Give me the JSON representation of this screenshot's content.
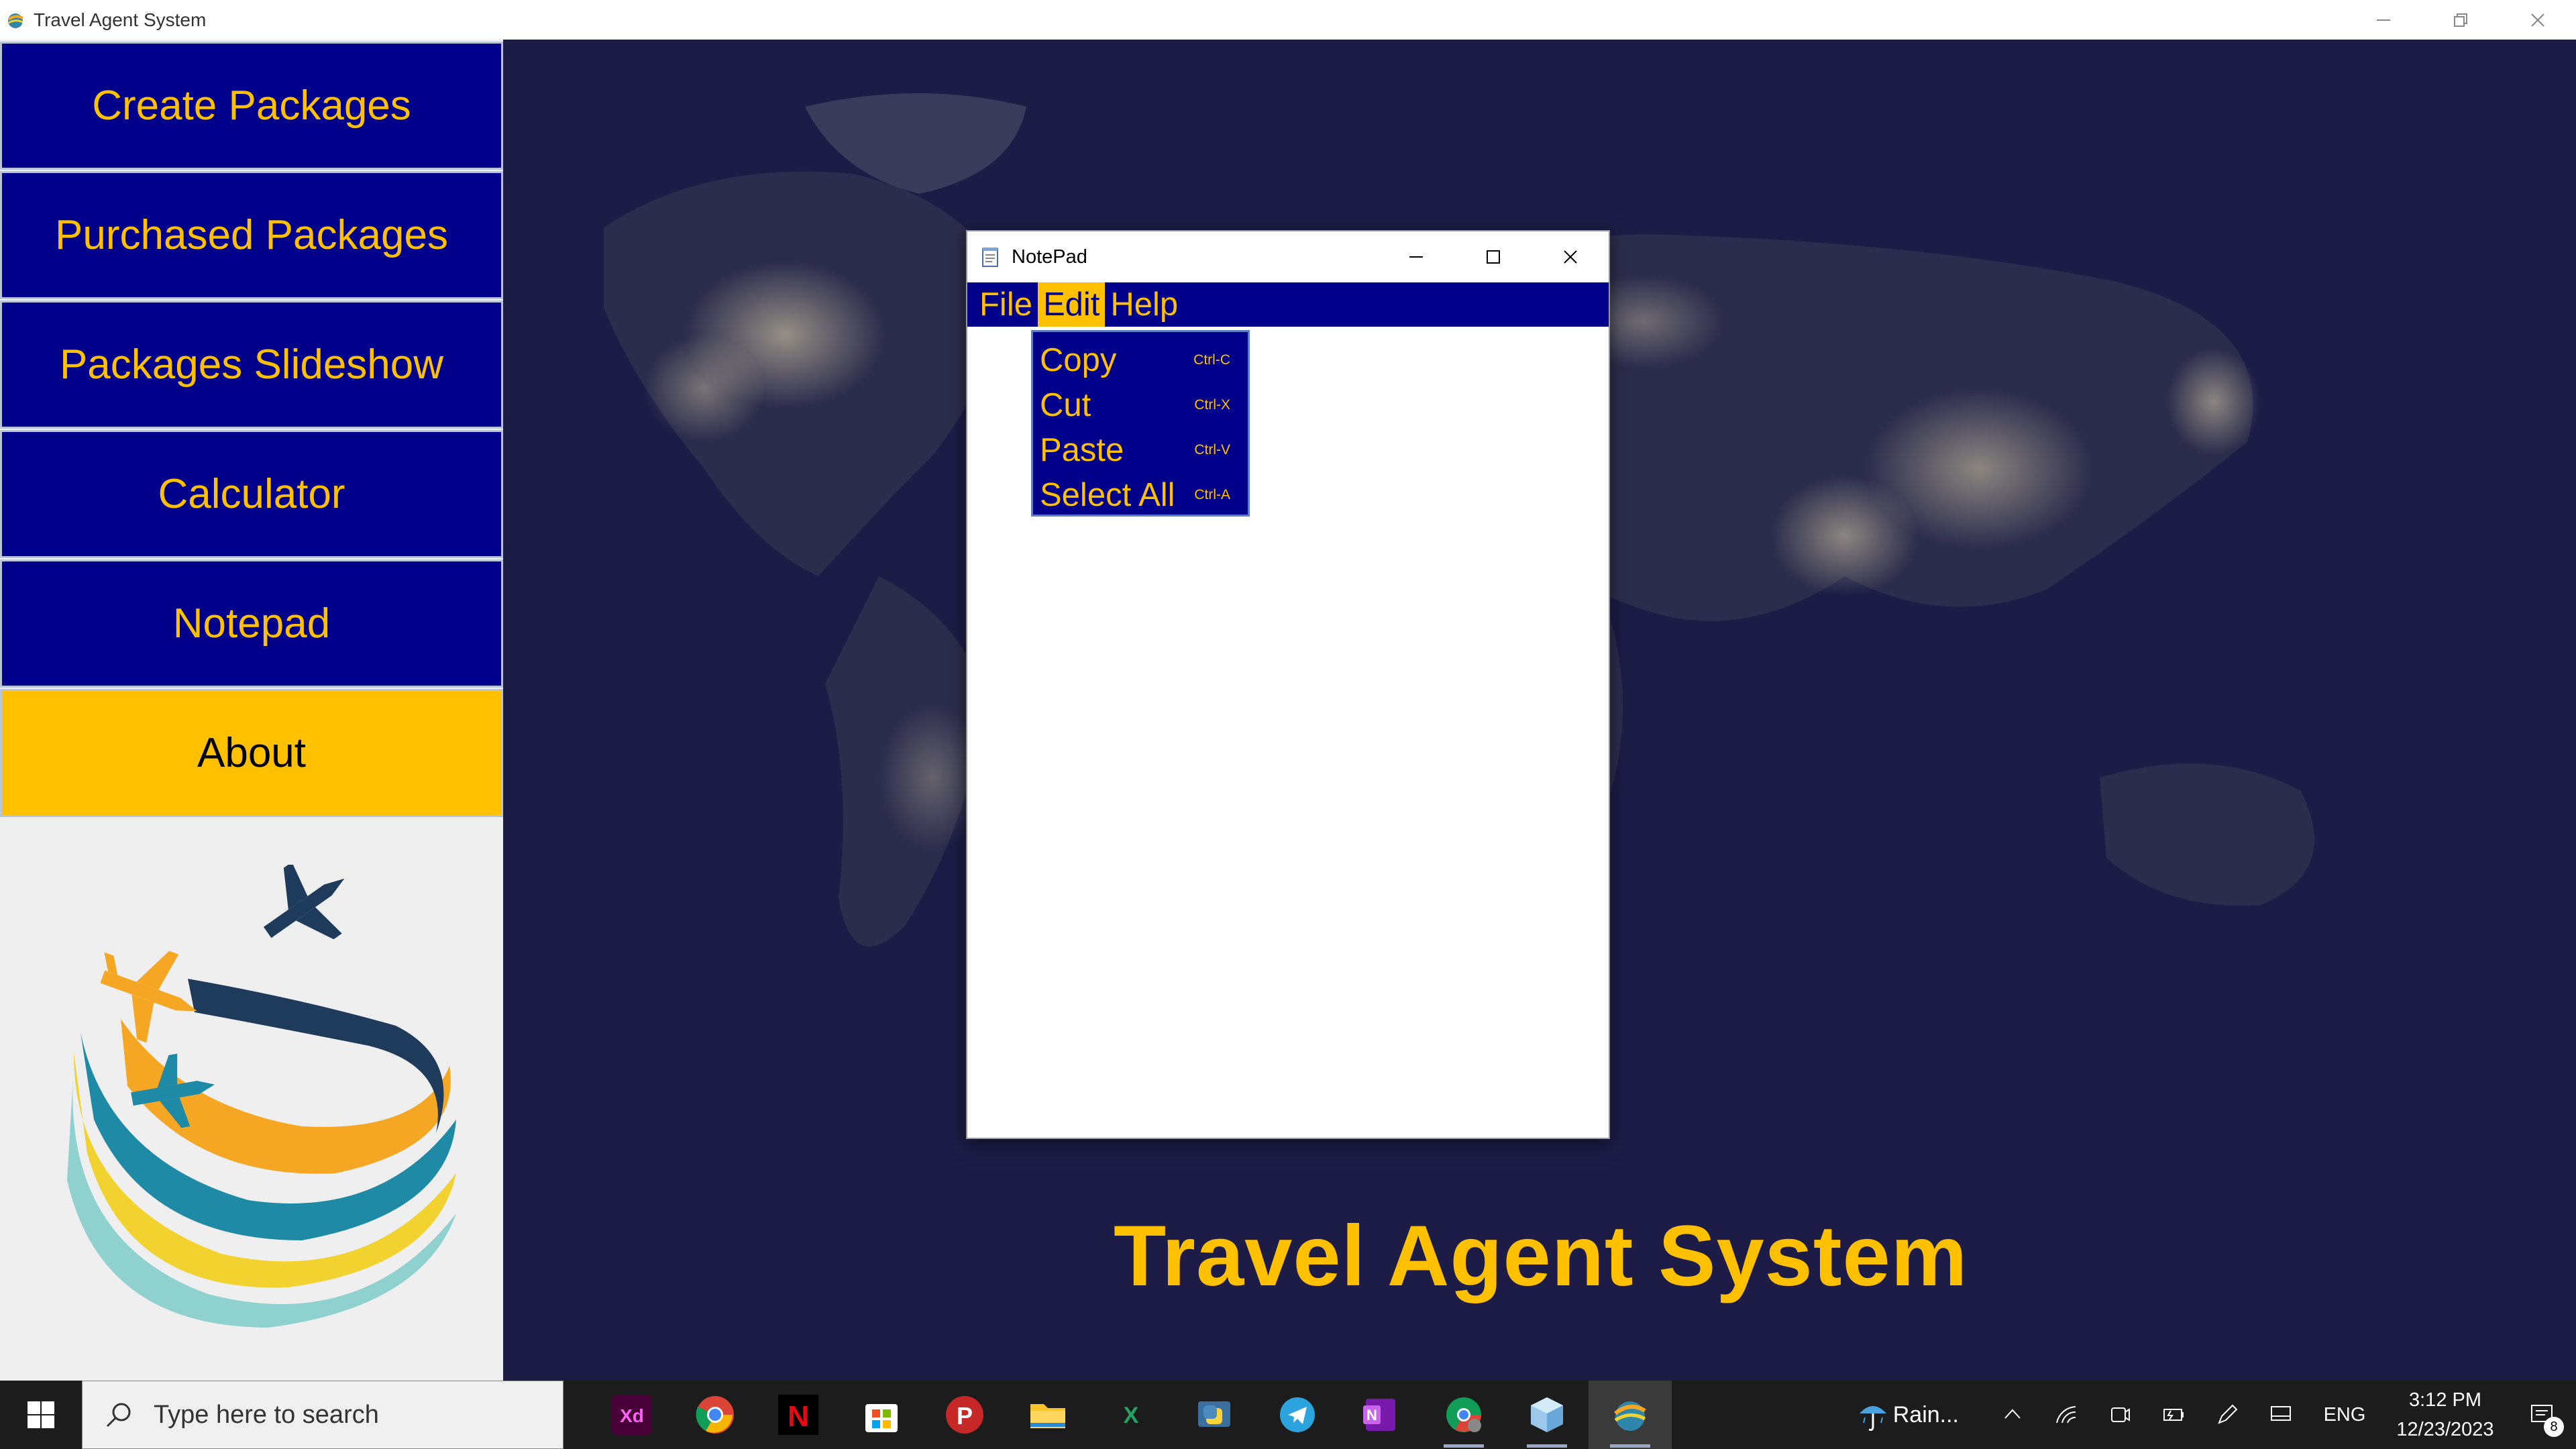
{
  "window": {
    "title": "Travel Agent System"
  },
  "sidebar": {
    "items": [
      {
        "label": "Create Packages"
      },
      {
        "label": "Purchased Packages"
      },
      {
        "label": "Packages Slideshow"
      },
      {
        "label": "Calculator"
      },
      {
        "label": "Notepad"
      },
      {
        "label": "About",
        "active": true
      }
    ]
  },
  "main": {
    "heading": "Travel Agent System"
  },
  "notepad": {
    "title": "NotePad",
    "menu": [
      {
        "label": "File"
      },
      {
        "label": "Edit",
        "open": true
      },
      {
        "label": "Help"
      }
    ],
    "edit_menu": [
      {
        "label": "Copy",
        "shortcut": "Ctrl-C"
      },
      {
        "label": "Cut",
        "shortcut": "Ctrl-X"
      },
      {
        "label": "Paste",
        "shortcut": "Ctrl-V"
      },
      {
        "label": "Select All",
        "shortcut": "Ctrl-A"
      }
    ],
    "content": ""
  },
  "taskbar": {
    "search_placeholder": "Type here to search",
    "apps": [
      "adobe-xd-icon",
      "chrome-icon",
      "netflix-icon",
      "microsoft-store-icon",
      "pdf-reader-icon",
      "file-explorer-icon",
      "excel-icon",
      "python-icon",
      "telegram-icon",
      "onenote-icon",
      "chrome-profile-icon",
      "virtualbox-icon",
      "travel-agent-app-icon"
    ],
    "weather": "Rain...",
    "language": "ENG",
    "time": "3:12 PM",
    "date": "12/23/2023",
    "notification_count": "8"
  },
  "colors": {
    "primary_blue": "#00008b",
    "accent_gold": "#ffc000",
    "map_background": "#1b1b44"
  }
}
